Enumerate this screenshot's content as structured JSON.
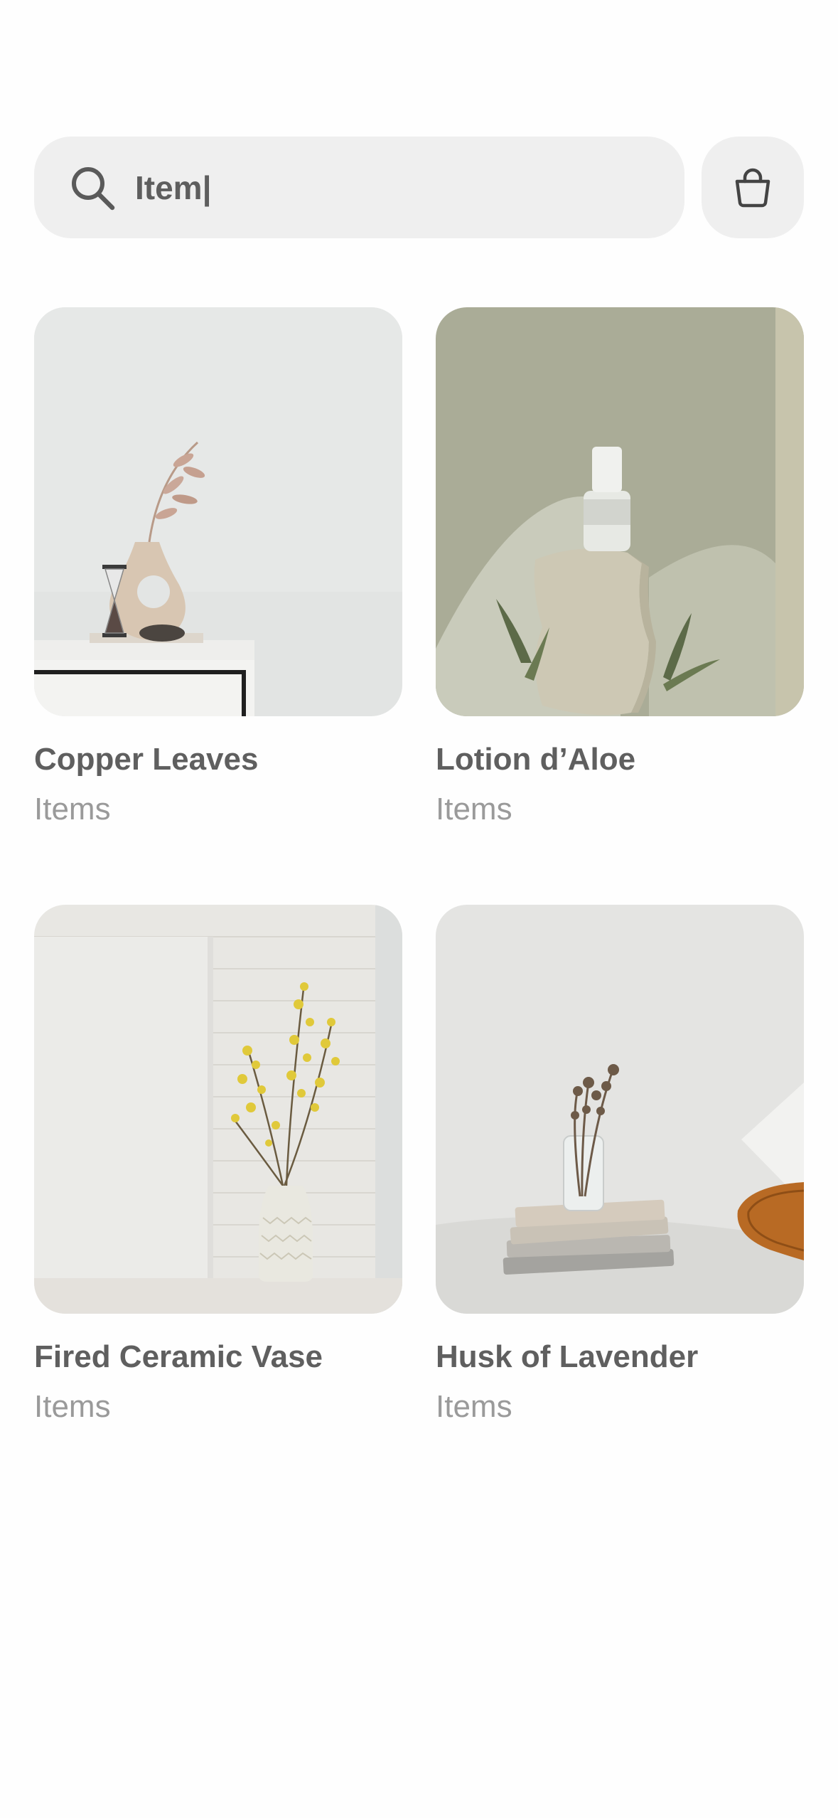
{
  "search": {
    "value": "Item|",
    "icon": "search-icon"
  },
  "cart": {
    "icon": "shopping-bag-icon"
  },
  "colors": {
    "background": "#fefefe",
    "field": "#efefef",
    "title_text": "#5f5f5f",
    "subtitle_text": "#9a9a9a"
  },
  "products": [
    {
      "title": "Copper Leaves",
      "subtitle": "Items"
    },
    {
      "title": "Lotion d’Aloe",
      "subtitle": "Items"
    },
    {
      "title": "Fired Ceramic Vase",
      "subtitle": "Items"
    },
    {
      "title": "Husk of Lavender",
      "subtitle": "Items"
    }
  ]
}
